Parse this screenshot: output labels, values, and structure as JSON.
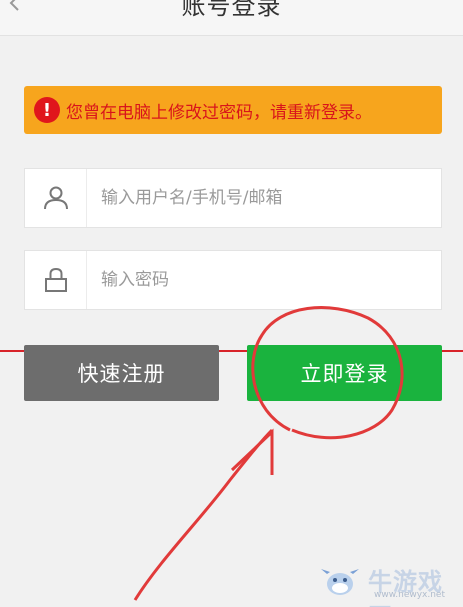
{
  "header": {
    "title": "账号登录",
    "back_icon": "chevron-left-icon"
  },
  "warning": {
    "icon": "exclamation-circle-icon",
    "icon_glyph": "!",
    "text": "您曾在电脑上修改过密码，请重新登录。",
    "background_color": "#f7a51d",
    "text_color": "#d9141b"
  },
  "form": {
    "username": {
      "icon": "user-icon",
      "value": "",
      "placeholder": "输入用户名/手机号/邮箱"
    },
    "password": {
      "icon": "lock-icon",
      "value": "",
      "placeholder": "输入密码"
    }
  },
  "buttons": {
    "register_label": "快速注册",
    "login_label": "立即登录",
    "register_color": "#6d6d6d",
    "login_color": "#1ab33e"
  },
  "watermark": {
    "name": "牛游戏网",
    "url": "www.newyx.net",
    "mascot": "cow-mascot-icon"
  }
}
